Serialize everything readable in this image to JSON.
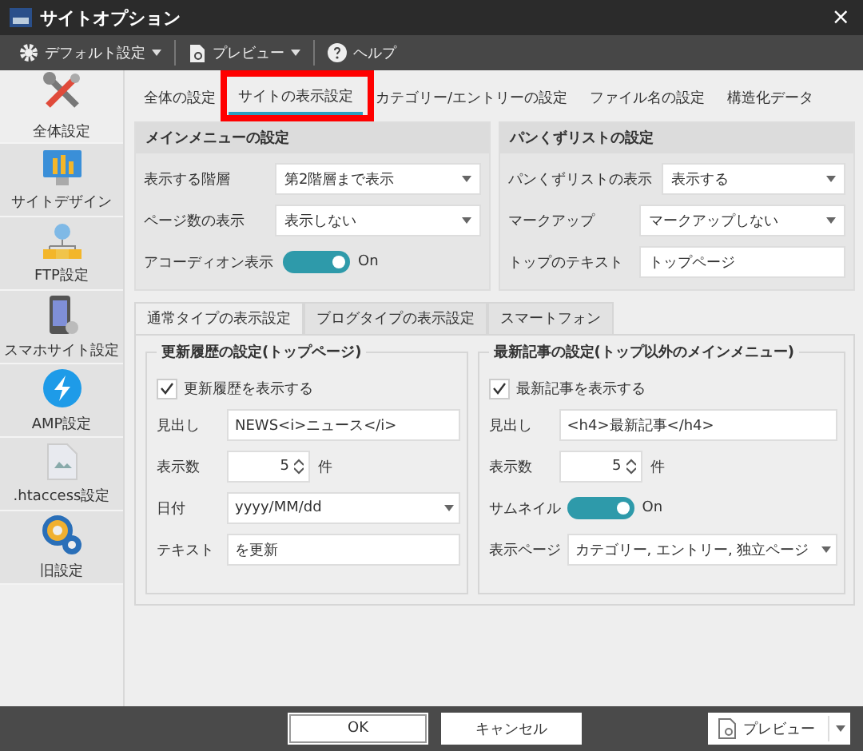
{
  "window": {
    "title": "サイトオプション",
    "close": "×"
  },
  "toolbar": [
    {
      "label": "デフォルト設定"
    },
    {
      "label": "プレビュー"
    },
    {
      "label": "ヘルプ"
    }
  ],
  "sidebar": {
    "items": [
      {
        "label": "全体設定",
        "selected": true
      },
      {
        "label": "サイトデザイン",
        "selected": false
      },
      {
        "label": "FTP設定",
        "selected": false
      },
      {
        "label": "スマホサイト設定",
        "selected": false
      },
      {
        "label": "AMP設定",
        "selected": false
      },
      {
        "label": ".htaccess設定",
        "selected": false
      },
      {
        "label": "旧設定",
        "selected": false
      }
    ]
  },
  "tabs": [
    {
      "label": "全体の設定",
      "selected": false,
      "highlighted": false
    },
    {
      "label": "サイトの表示設定",
      "selected": true,
      "highlighted": true
    },
    {
      "label": "カテゴリー/エントリーの設定",
      "selected": false,
      "highlighted": false
    },
    {
      "label": "ファイル名の設定",
      "selected": false,
      "highlighted": false
    },
    {
      "label": "構造化データ",
      "selected": false,
      "highlighted": false
    }
  ],
  "panels": [
    {
      "title": "メインメニューの設定",
      "rows": [
        {
          "kind": "select",
          "label": "表示する階層",
          "value": "第2階層まで表示"
        },
        {
          "kind": "select",
          "label": "ページ数の表示",
          "value": "表示しない"
        },
        {
          "kind": "toggle",
          "label": "アコーディオン表示",
          "on": true,
          "state_text": "On"
        }
      ]
    },
    {
      "title": "パンくずリストの設定",
      "rows": [
        {
          "kind": "select",
          "label": "パンくずリストの表示",
          "value": "表示する"
        },
        {
          "kind": "select",
          "label": "マークアップ",
          "value": "マークアップしない"
        },
        {
          "kind": "text",
          "label": "トップのテキスト",
          "value": "トップページ"
        }
      ]
    }
  ],
  "subtabs": [
    {
      "label": "通常タイプの表示設定",
      "selected": true
    },
    {
      "label": "ブログタイプの表示設定",
      "selected": false
    },
    {
      "label": "スマートフォン",
      "selected": false
    }
  ],
  "groups": [
    {
      "title": "更新履歴の設定(トップページ)",
      "checkbox": {
        "label": "更新履歴を表示する",
        "checked": true
      },
      "rows": [
        {
          "kind": "text",
          "label": "見出し",
          "value": "NEWS<i>ニュース</i>"
        },
        {
          "kind": "spin",
          "label": "表示数",
          "value": "5",
          "unit": "件"
        },
        {
          "kind": "select",
          "label": "日付",
          "value": "yyyy/MM/dd"
        },
        {
          "kind": "text",
          "label": "テキスト",
          "value": "を更新"
        }
      ]
    },
    {
      "title": "最新記事の設定(トップ以外のメインメニュー)",
      "checkbox": {
        "label": "最新記事を表示する",
        "checked": true
      },
      "rows": [
        {
          "kind": "text",
          "label": "見出し",
          "value": "<h4>最新記事</h4>"
        },
        {
          "kind": "spin",
          "label": "表示数",
          "value": "5",
          "unit": "件"
        },
        {
          "kind": "toggle",
          "label": "サムネイル",
          "on": true,
          "state_text": "On"
        },
        {
          "kind": "select",
          "label": "表示ページ",
          "value": "カテゴリー, エントリー, 独立ページ"
        }
      ]
    }
  ],
  "footer": {
    "ok": "OK",
    "cancel": "キャンセル",
    "preview": "プレビュー"
  }
}
